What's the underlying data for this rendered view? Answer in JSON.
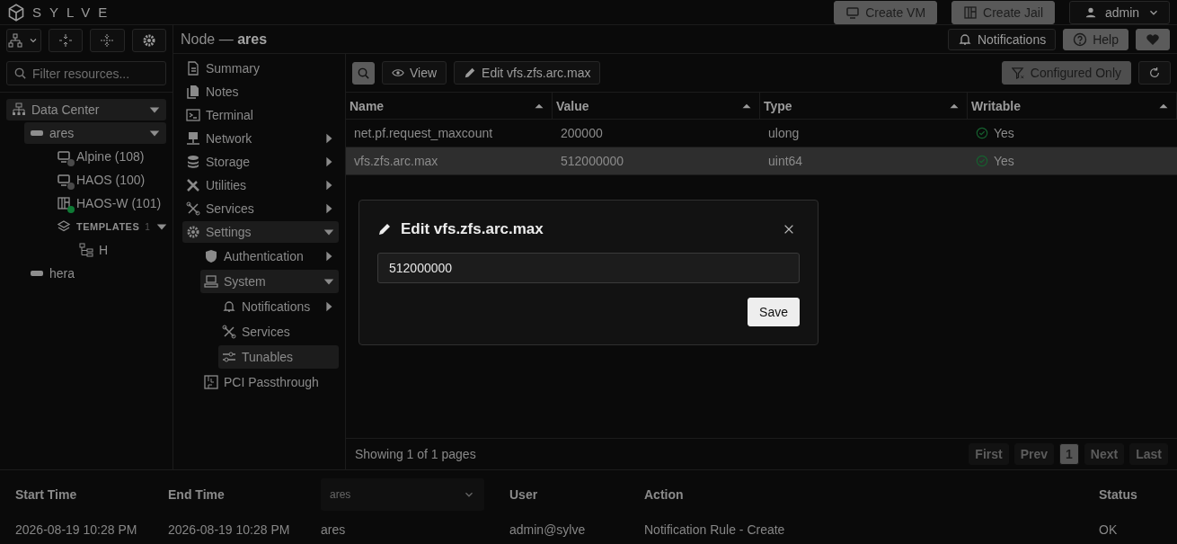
{
  "app": {
    "logo_text": "SYLVE"
  },
  "header_buttons": [
    {
      "label": "Create VM",
      "kind": "vm"
    },
    {
      "label": "Create Jail",
      "kind": "jail"
    }
  ],
  "user_menu": {
    "label": "admin"
  },
  "sidebar": {
    "filter": {
      "placeholder": "Filter resources..."
    },
    "tree": [
      {
        "label": "Data Center",
        "kind": "datacenter",
        "selected": true,
        "expanded": true,
        "children": [
          {
            "label": "ares",
            "kind": "node",
            "selected": true,
            "expanded": true,
            "children": [
              {
                "label": "Alpine (108)",
                "kind": "vm",
                "selected": false,
                "color": "#4a4a4a"
              },
              {
                "label": "HAOS (100)",
                "kind": "vm",
                "selected": false,
                "color": "#4a4a4a"
              },
              {
                "label": "HAOS-W (101)",
                "kind": "jail",
                "selected": false,
                "color": "#0f7a35"
              },
              {
                "label": "TEMPLATES",
                "kind": "group",
                "count": "1",
                "selected": false,
                "expanded": true,
                "children": [
                  {
                    "label": "H",
                    "kind": "template",
                    "selected": false
                  }
                ]
              }
            ]
          },
          {
            "label": "hera",
            "kind": "node",
            "selected": false
          }
        ]
      }
    ]
  },
  "page_title": "Node — **ares**",
  "top_buttons": [
    {
      "label": "Notifications",
      "kind": "bell"
    },
    {
      "label": "Help",
      "kind": "help"
    },
    {
      "kind": "heart"
    }
  ],
  "nav": [
    {
      "label": "Summary",
      "kind": "doc",
      "selected": false
    },
    {
      "label": "Notes",
      "kind": "notes",
      "selected": false
    },
    {
      "label": "Terminal",
      "kind": "terminal",
      "selected": false
    },
    {
      "label": "Network",
      "kind": "network",
      "selected": false,
      "expanded": false
    },
    {
      "label": "Storage",
      "kind": "storage",
      "selected": false,
      "expanded": false
    },
    {
      "label": "Utilities",
      "kind": "tools",
      "selected": false,
      "expanded": false
    },
    {
      "label": "Services",
      "kind": "services",
      "selected": false,
      "expanded": false
    },
    {
      "label": "Settings",
      "kind": "gear",
      "selected": true,
      "expanded": true,
      "children": [
        {
          "label": "Authentication",
          "kind": "shield",
          "selected": false,
          "expanded": false
        },
        {
          "label": "System",
          "kind": "system",
          "selected": true,
          "expanded": true,
          "children": [
            {
              "label": "Notifications",
              "kind": "bell",
              "selected": false,
              "expanded": false
            },
            {
              "label": "Services",
              "kind": "services",
              "selected": false
            },
            {
              "label": "Tunables",
              "kind": "sliders",
              "selected": true
            }
          ]
        },
        {
          "label": "PCI Passthrough",
          "kind": "pci",
          "selected": false
        }
      ]
    }
  ],
  "toolbar": {
    "buttons": [
      {
        "label": "View",
        "kind": "eye"
      },
      {
        "label": "Edit vfs.zfs.arc.max",
        "kind": "pencil"
      }
    ],
    "filter_toggle": {
      "label": "Configured Only",
      "selected": true
    }
  },
  "table": {
    "columns": [
      "Name",
      "Value",
      "Type",
      "Writable"
    ],
    "rows": [
      {
        "name": "net.pf.request_maxcount",
        "value": "200000",
        "type": "ulong",
        "writable": "Yes",
        "selected": false
      },
      {
        "name": "vfs.zfs.arc.max",
        "value": "512000000",
        "type": "uint64",
        "writable": "Yes",
        "selected": true
      }
    ]
  },
  "pagination": {
    "summary": "Showing 1 of 1 pages",
    "buttons": [
      {
        "label": "First",
        "selected": false,
        "disabled": true
      },
      {
        "label": "Prev",
        "selected": false,
        "disabled": true
      },
      {
        "label": "1",
        "selected": true,
        "disabled": false
      },
      {
        "label": "Next",
        "selected": false,
        "disabled": true
      },
      {
        "label": "Last",
        "selected": false,
        "disabled": true
      }
    ]
  },
  "dialog": {
    "title": "Edit vfs.zfs.arc.max",
    "value": "512000000",
    "save": "Save"
  },
  "audit": {
    "columns": [
      {
        "kind": "text",
        "label": "Start Time"
      },
      {
        "kind": "text",
        "label": "End Time"
      },
      {
        "kind": "select",
        "label": "ares"
      },
      {
        "kind": "text",
        "label": "User"
      },
      {
        "kind": "text",
        "label": "Action"
      },
      {
        "kind": "text",
        "label": "Status"
      }
    ],
    "rows": [
      [
        "2026-08-19 10:28 PM",
        "2026-08-19 10:28 PM",
        "ares",
        "admin@sylve",
        "Notification Rule - Create",
        "OK"
      ]
    ]
  }
}
